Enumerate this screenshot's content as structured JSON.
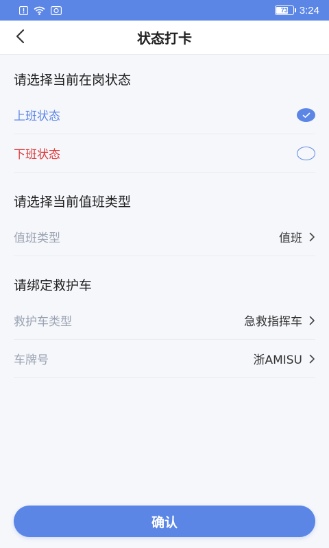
{
  "status_bar": {
    "icons": [
      "notification-icon",
      "wifi-icon",
      "app-icon"
    ],
    "battery": "73",
    "battery_level": 0.73,
    "time": "3:24"
  },
  "header": {
    "back_icon": "chevron-left-icon",
    "title": "状态打卡"
  },
  "sections": {
    "status": {
      "title": "请选择当前在岗状态",
      "options": [
        {
          "label": "上班状态",
          "checked": true,
          "color": "#5b86e5"
        },
        {
          "label": "下班状态",
          "checked": false,
          "color": "#dd3b3b"
        }
      ]
    },
    "duty": {
      "title": "请选择当前值班类型",
      "rows": [
        {
          "label": "值班类型",
          "value": "值班"
        }
      ]
    },
    "ambulance": {
      "title": "请绑定救护车",
      "rows": [
        {
          "label": "救护车类型",
          "value": "急救指挥车"
        },
        {
          "label": "车牌号",
          "value": "浙AMISU"
        }
      ]
    }
  },
  "confirm_label": "确认",
  "colors": {
    "accent": "#5b86e5",
    "danger": "#dd3b3b",
    "muted": "#9aa3b2",
    "background": "#f6f7fb"
  }
}
